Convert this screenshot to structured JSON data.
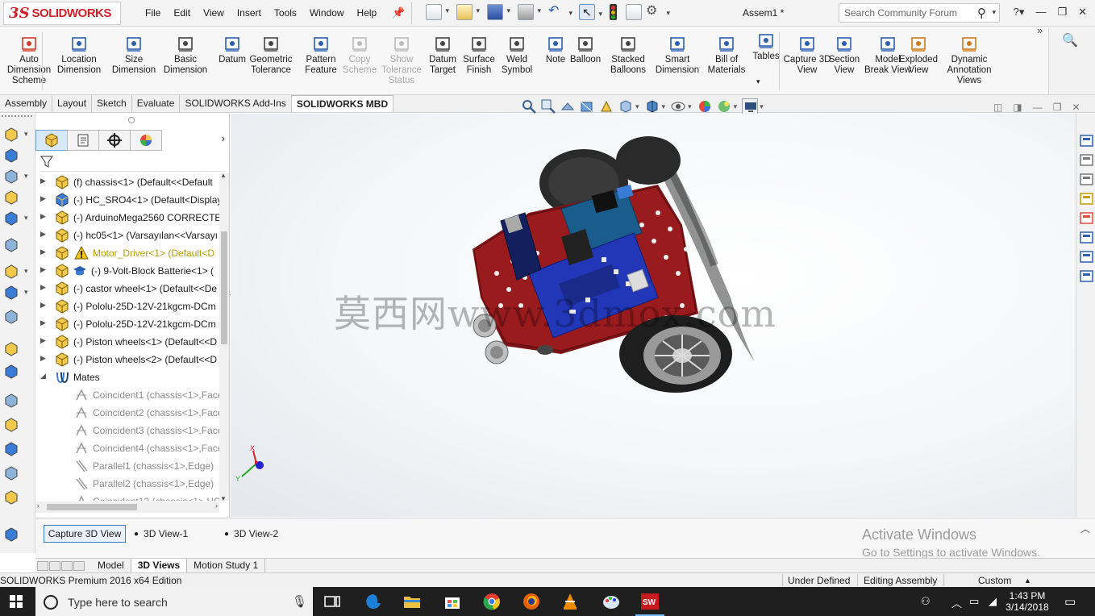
{
  "app": {
    "brand_ds": "3S",
    "brand_name": "SOLIDWORKS",
    "document_title": "Assem1 *"
  },
  "menu": [
    "File",
    "Edit",
    "View",
    "Insert",
    "Tools",
    "Window",
    "Help"
  ],
  "search": {
    "placeholder": "Search Community Forum"
  },
  "ribbon_tools": [
    {
      "label": "Auto Dimension Scheme",
      "icon": "auto-dimension-icon",
      "disabled": false
    },
    {
      "label": "Location Dimension",
      "icon": "location-dimension-icon",
      "disabled": false
    },
    {
      "label": "Size Dimension",
      "icon": "size-dimension-icon",
      "disabled": false
    },
    {
      "label": "Basic Dimension",
      "icon": "basic-dimension-icon",
      "disabled": false
    },
    {
      "label": "Datum",
      "icon": "datum-icon",
      "disabled": false
    },
    {
      "label": "Geometric Tolerance",
      "icon": "geometric-tolerance-icon",
      "disabled": false
    },
    {
      "label": "Pattern Feature",
      "icon": "pattern-feature-icon",
      "disabled": false
    },
    {
      "label": "Copy Scheme",
      "icon": "copy-scheme-icon",
      "disabled": true
    },
    {
      "label": "Show Tolerance Status",
      "icon": "tolerance-status-icon",
      "disabled": true
    },
    {
      "label": "Datum Target",
      "icon": "datum-target-icon",
      "disabled": false
    },
    {
      "label": "Surface Finish",
      "icon": "surface-finish-icon",
      "disabled": false
    },
    {
      "label": "Weld Symbol",
      "icon": "weld-symbol-icon",
      "disabled": false
    },
    {
      "label": "Note",
      "icon": "note-icon",
      "disabled": false
    },
    {
      "label": "Balloon",
      "icon": "balloon-icon",
      "disabled": false
    },
    {
      "label": "Stacked Balloons",
      "icon": "stacked-balloons-icon",
      "disabled": false
    },
    {
      "label": "Smart Dimension",
      "icon": "smart-dimension-icon",
      "disabled": false
    },
    {
      "label": "Bill of Materials",
      "icon": "bill-of-materials-icon",
      "disabled": false
    },
    {
      "label": "Tables",
      "icon": "tables-icon",
      "disabled": false
    },
    {
      "label": "Capture 3D View",
      "icon": "capture-3d-view-icon",
      "disabled": false
    },
    {
      "label": "Section View",
      "icon": "section-view-icon",
      "disabled": false
    },
    {
      "label": "Model Break View",
      "icon": "model-break-view-icon",
      "disabled": false
    },
    {
      "label": "Exploded View",
      "icon": "exploded-view-icon",
      "disabled": false
    },
    {
      "label": "Dynamic Annotation Views",
      "icon": "dynamic-annotation-views-icon",
      "disabled": false
    }
  ],
  "cm_tabs": [
    {
      "label": "Assembly",
      "active": false
    },
    {
      "label": "Layout",
      "active": false
    },
    {
      "label": "Sketch",
      "active": false
    },
    {
      "label": "Evaluate",
      "active": false
    },
    {
      "label": "SOLIDWORKS Add-Ins",
      "active": false
    },
    {
      "label": "SOLIDWORKS MBD",
      "active": true
    }
  ],
  "tree": [
    {
      "label": "(f) chassis<1> (Default<<Default",
      "type": "part",
      "expand": true,
      "level": 1
    },
    {
      "label": "(-) HC_SRO4<1> (Default<Display",
      "type": "assembly",
      "expand": true,
      "level": 1
    },
    {
      "label": "(-) ArduinoMega2560 CORRECTEI",
      "type": "part",
      "expand": true,
      "level": 1
    },
    {
      "label": "(-) hc05<1> (Varsayılan<<Varsayı",
      "type": "part",
      "expand": true,
      "level": 1
    },
    {
      "label": "Motor_Driver<1> (Default<D",
      "type": "warning",
      "expand": true,
      "level": 1
    },
    {
      "label": "(-) 9-Volt-Block Batterie<1> (",
      "type": "cap",
      "expand": true,
      "level": 1
    },
    {
      "label": "(-) castor wheel<1> (Default<<De",
      "type": "part",
      "expand": true,
      "level": 1
    },
    {
      "label": "(-) Pololu-25D-12V-21kgcm-DCm",
      "type": "part",
      "expand": true,
      "level": 1
    },
    {
      "label": "(-) Pololu-25D-12V-21kgcm-DCm",
      "type": "part",
      "expand": true,
      "level": 1
    },
    {
      "label": "(-) Piston wheels<1> (Default<<D",
      "type": "part",
      "expand": true,
      "level": 1
    },
    {
      "label": "(-) Piston wheels<2> (Default<<D",
      "type": "part",
      "expand": true,
      "level": 1
    },
    {
      "label": "Mates",
      "type": "mates",
      "expand": "open",
      "level": 1
    },
    {
      "label": "Coincident1 (chassis<1>,Face",
      "type": "coincident",
      "expand": false,
      "level": 2
    },
    {
      "label": "Coincident2 (chassis<1>,Face",
      "type": "coincident",
      "expand": false,
      "level": 2
    },
    {
      "label": "Coincident3 (chassis<1>,Face",
      "type": "coincident",
      "expand": false,
      "level": 2
    },
    {
      "label": "Coincident4 (chassis<1>,Face",
      "type": "coincident",
      "expand": false,
      "level": 2
    },
    {
      "label": "Parallel1 (chassis<1>,Edge)",
      "type": "parallel",
      "expand": false,
      "level": 2
    },
    {
      "label": "Parallel2 (chassis<1>,Edge)",
      "type": "parallel",
      "expand": false,
      "level": 2
    },
    {
      "label": "Coincident13 (chassis<1>,HC",
      "type": "coincident",
      "expand": false,
      "level": 2
    }
  ],
  "viewport": {
    "watermark": "莫西网www.3dmox.com",
    "triad_x": "X",
    "triad_y": "Y"
  },
  "views_panel": {
    "capture_label": "Capture 3D View",
    "views": [
      "3D View-1",
      "3D View-2"
    ],
    "activate_title": "Activate Windows",
    "activate_sub": "Go to Settings to activate Windows."
  },
  "bottom_tabs": [
    {
      "label": "Model",
      "active": false
    },
    {
      "label": "3D Views",
      "active": true
    },
    {
      "label": "Motion Study 1",
      "active": false
    }
  ],
  "status": {
    "edition": "SOLIDWORKS Premium 2016 x64 Edition",
    "definition": "Under Defined",
    "mode": "Editing Assembly",
    "units": "Custom"
  },
  "taskbar": {
    "search_placeholder": "Type here to search",
    "time": "1:43 PM",
    "date": "3/14/2018"
  }
}
